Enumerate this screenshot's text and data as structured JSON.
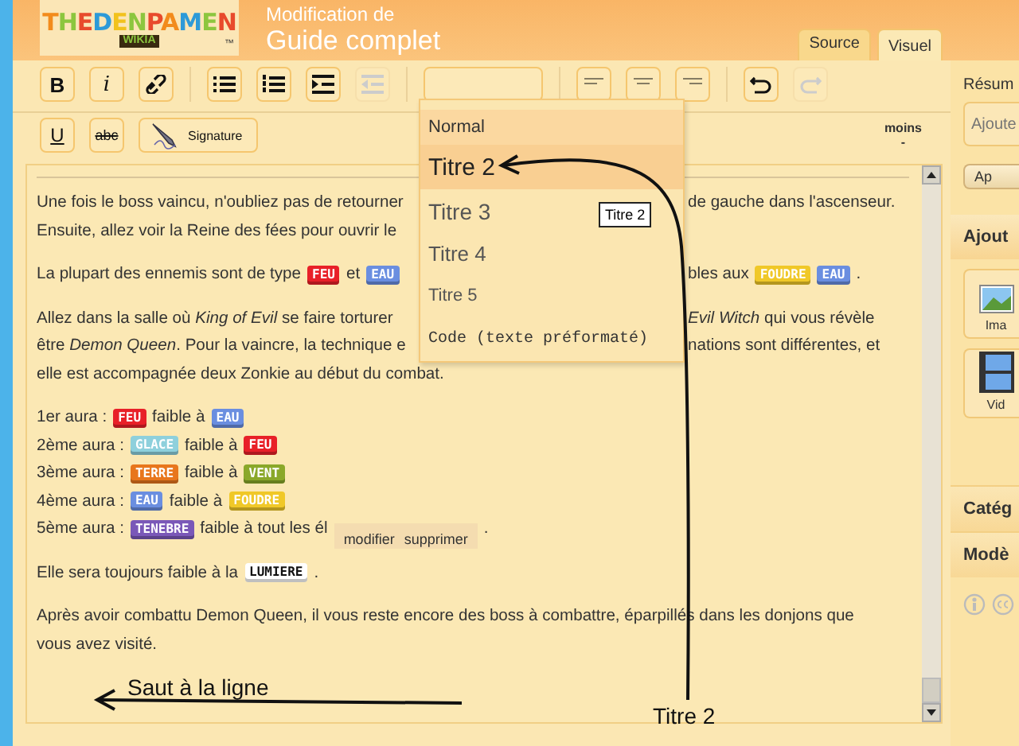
{
  "header": {
    "logo": {
      "text": "THEDENPAMEN",
      "sub": "WIKIA",
      "mark": "™"
    },
    "caption": "Modification de",
    "title": "Guide complet"
  },
  "tabs": [
    {
      "label": "Source",
      "selected": false
    },
    {
      "label": "Visuel",
      "selected": true
    }
  ],
  "toolbar": {
    "row_1": [
      [
        {
          "kind": "bold",
          "label": "B",
          "disabled": false
        },
        {
          "kind": "italic",
          "label": "i",
          "disabled": false
        },
        {
          "kind": "link",
          "disabled": false
        }
      ],
      [
        {
          "kind": "bullets",
          "disabled": false
        },
        {
          "kind": "numbers",
          "disabled": false
        },
        {
          "kind": "indent",
          "disabled": false
        },
        {
          "kind": "outdent",
          "disabled": true
        }
      ],
      [
        {
          "kind": "format",
          "disabled": false
        }
      ],
      [
        {
          "kind": "align_left",
          "disabled": false
        },
        {
          "kind": "align_center",
          "disabled": false
        },
        {
          "kind": "align_right",
          "disabled": false
        }
      ],
      [
        {
          "kind": "undo",
          "disabled": false
        },
        {
          "kind": "redo",
          "disabled": true
        }
      ]
    ],
    "row_2": [
      {
        "kind": "underline",
        "label": "U",
        "disabled": false
      },
      {
        "kind": "strike",
        "label": "abc",
        "disabled": false
      },
      {
        "kind": "signature",
        "label": "Signature",
        "disabled": false
      }
    ],
    "minor": {
      "label": "moins",
      "value": "-"
    }
  },
  "content": [
    {
      "lines": [
        {
          "left": [
            {
              "kind": "text",
              "text": "Une fois le boss vaincu, n'oubliez pas de retourner"
            }
          ],
          "right": [
            {
              "kind": "text",
              "text": "de gauche dans l'ascenseur."
            }
          ]
        },
        {
          "left": [
            {
              "kind": "text",
              "text": "Ensuite, allez voir la Reine des fées pour ouvrir le"
            }
          ]
        }
      ]
    },
    {
      "lines": [
        {
          "left": [
            {
              "kind": "text",
              "text": "La plupart des ennemis sont de type"
            },
            {
              "kind": "tag",
              "text": "FEU",
              "color": "#e82028"
            },
            {
              "kind": "text",
              "text": "et"
            },
            {
              "kind": "tag",
              "text": "EAU",
              "color": "#6a8ee0"
            }
          ],
          "right": [
            {
              "kind": "text",
              "text": "bles aux"
            },
            {
              "kind": "tag",
              "text": "FOUDRE",
              "color": "#f0c828"
            },
            {
              "kind": "tag",
              "text": "EAU",
              "color": "#6a8ee0"
            },
            {
              "kind": "text",
              "text": "."
            }
          ]
        }
      ]
    },
    {
      "lines": [
        {
          "left": [
            {
              "kind": "text",
              "text": "Allez dans la salle où *King of Evil* se faire torturer"
            }
          ],
          "right": [
            {
              "kind": "text",
              "text": "*Evil Witch* qui vous révèle"
            }
          ]
        },
        {
          "left": [
            {
              "kind": "text",
              "text": "être *Demon Queen*. Pour la vaincre, la technique e"
            }
          ],
          "right": [
            {
              "kind": "text",
              "text": "nations sont différentes, et"
            }
          ]
        },
        {
          "left": [
            {
              "kind": "text",
              "text": "elle est accompagnée deux Zonkie au début du combat."
            }
          ]
        }
      ]
    },
    {
      "lines": [
        {
          "left": [
            {
              "kind": "text",
              "text": "1er aura :"
            },
            {
              "kind": "tag",
              "text": "FEU",
              "color": "#e82028"
            },
            {
              "kind": "text",
              "text": "faible à"
            },
            {
              "kind": "tag",
              "text": "EAU",
              "color": "#6a8ee0"
            }
          ]
        },
        {
          "left": [
            {
              "kind": "text",
              "text": "2ème aura :"
            },
            {
              "kind": "tag",
              "text": "GLACE",
              "color": "#8ed0dc"
            },
            {
              "kind": "text",
              "text": "faible à"
            },
            {
              "kind": "tag",
              "text": "FEU",
              "color": "#e82028"
            }
          ]
        },
        {
          "left": [
            {
              "kind": "text",
              "text": "3ème aura :"
            },
            {
              "kind": "tag",
              "text": "TERRE",
              "color": "#e8761c"
            },
            {
              "kind": "text",
              "text": "faible à"
            },
            {
              "kind": "tag",
              "text": "VENT",
              "color": "#8aa82a"
            }
          ]
        },
        {
          "left": [
            {
              "kind": "text",
              "text": "4ème aura :"
            },
            {
              "kind": "tag",
              "text": "EAU",
              "color": "#6a8ee0"
            },
            {
              "kind": "text",
              "text": "faible à"
            },
            {
              "kind": "tag",
              "text": "FOUDRE",
              "color": "#f0c828"
            }
          ]
        },
        {
          "left": [
            {
              "kind": "text",
              "text": "5ème aura :"
            },
            {
              "kind": "tag",
              "text": "TENEBRE",
              "color": "#7a58b8"
            },
            {
              "kind": "text",
              "text": "faible à tout les él"
            },
            {
              "kind": "popup",
              "links": [
                "modifier",
                "supprimer"
              ]
            },
            {
              "kind": "text",
              "text": "."
            }
          ]
        }
      ]
    },
    {
      "lines": [
        {
          "left": [
            {
              "kind": "text",
              "text": "Elle sera toujours faible à la"
            },
            {
              "kind": "tag",
              "text": "LUMIERE",
              "color": "#ffffff"
            },
            {
              "kind": "text",
              "text": "."
            }
          ]
        }
      ]
    },
    {
      "lines": [
        {
          "left": [
            {
              "kind": "text",
              "text": "Après avoir combattu Demon Queen, il vous reste encore des boss à combattre, éparpillés dans les donjons que"
            }
          ]
        },
        {
          "left": [
            {
              "kind": "text",
              "text": "vous avez visité."
            }
          ]
        }
      ]
    }
  ],
  "format_menu": {
    "items": [
      {
        "label": "Normal",
        "kind": "normal",
        "selected": false,
        "current": true
      },
      {
        "label": "Titre 2",
        "kind": "h2",
        "selected": true
      },
      {
        "label": "Titre 3",
        "kind": "h3",
        "selected": false
      },
      {
        "label": "Titre 4",
        "kind": "h4",
        "selected": false
      },
      {
        "label": "Titre 5",
        "kind": "h5",
        "selected": false
      },
      {
        "label": "Code (texte préformaté)",
        "kind": "code",
        "selected": false
      }
    ],
    "tooltip": "Titre 2"
  },
  "sidebar": {
    "summary_label": "Résum",
    "summary_placeholder": "Ajoute",
    "apply_button": "Ap",
    "add_title": "Ajout",
    "add_items": [
      {
        "kind": "image",
        "label": "Ima"
      },
      {
        "kind": "video",
        "label": "Vid"
      }
    ],
    "sections": [
      "Catég",
      "Modè"
    ]
  },
  "annotations": [
    {
      "kind": "curve_up",
      "text": "Titre 2"
    },
    {
      "kind": "arrow_left",
      "text": "Saut à la ligne"
    }
  ]
}
